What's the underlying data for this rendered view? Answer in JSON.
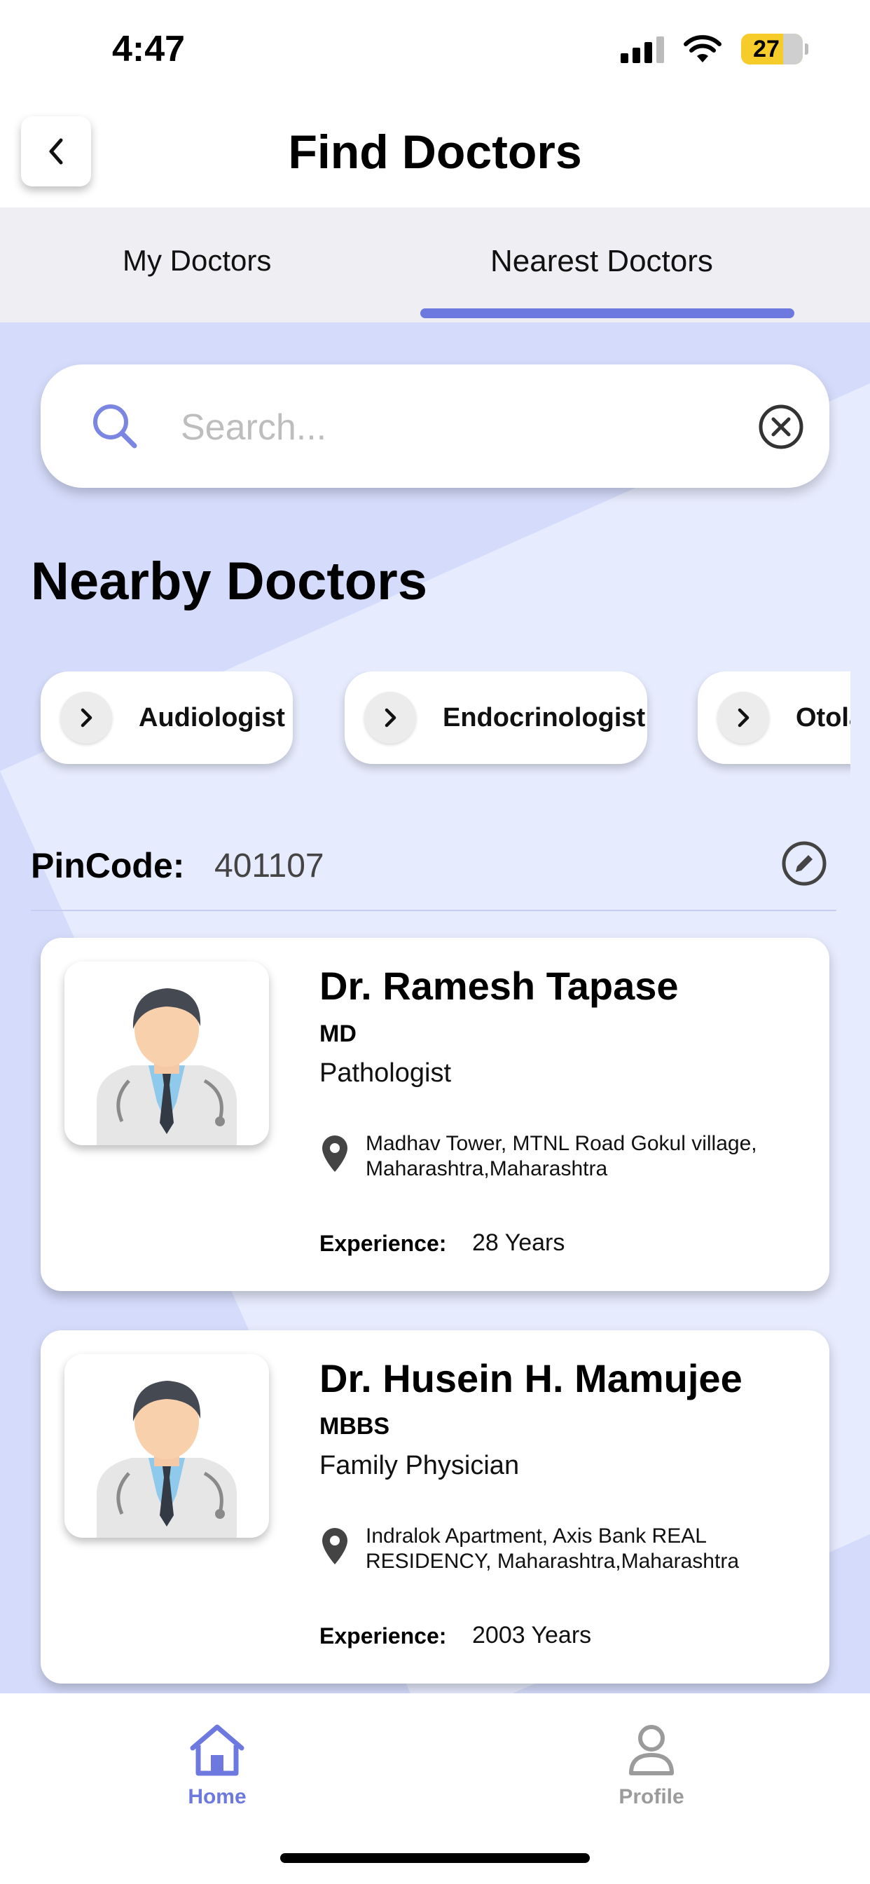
{
  "status_bar": {
    "time": "4:47",
    "battery": "27"
  },
  "header": {
    "title": "Find Doctors"
  },
  "tabs": [
    {
      "label": "My Doctors",
      "active": false
    },
    {
      "label": "Nearest Doctors",
      "active": true
    }
  ],
  "search": {
    "placeholder": "Search...",
    "value": ""
  },
  "section": {
    "title": "Nearby Doctors"
  },
  "categories": [
    "Audiologist",
    "Endocrinologist",
    "Otolaryngologist"
  ],
  "pincode": {
    "label": "PinCode:",
    "value": "401107"
  },
  "doctors": [
    {
      "name": "Dr. Ramesh Tapase",
      "degree": "MD",
      "specialization": "Pathologist",
      "address": "Madhav Tower, MTNL Road Gokul village, Maharashtra,Maharashtra",
      "experience_label": "Experience:",
      "experience": "28 Years"
    },
    {
      "name": "Dr. Husein H. Mamujee",
      "degree": "MBBS",
      "specialization": "Family Physician",
      "address": "Indralok Apartment, Axis Bank REAL RESIDENCY, Maharashtra,Maharashtra",
      "experience_label": "Experience:",
      "experience": "2003 Years"
    }
  ],
  "bottom_nav": [
    {
      "label": "Home",
      "icon": "home-icon",
      "active": true
    },
    {
      "label": "Profile",
      "icon": "user-icon",
      "active": false
    }
  ],
  "colors": {
    "accent": "#6e79e0",
    "background": "#d5dcfb",
    "tab_bar": "#efeff3"
  }
}
